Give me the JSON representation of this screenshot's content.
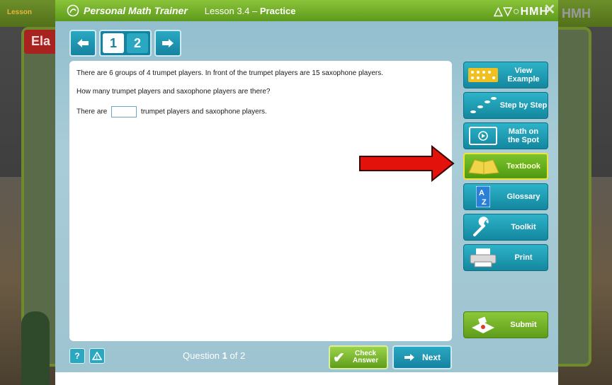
{
  "background": {
    "header_left": "Lesson",
    "header_right": "HMH",
    "title_fragment": "Ela"
  },
  "header": {
    "app_title": "Personal Math Trainer",
    "lesson_number": "Lesson 3.4",
    "lesson_separator": " – ",
    "lesson_mode": "Practice",
    "brand": "HMH"
  },
  "nav": {
    "pages": [
      "1",
      "2"
    ],
    "active_page": "1"
  },
  "question": {
    "line1": "There are 6 groups of 4 trumpet players. In front of the trumpet players are 15 saxophone players.",
    "line2": "How many trumpet players and saxophone players are there?",
    "answer_prefix": "There are",
    "answer_suffix": "trumpet players and saxophone players.",
    "answer_value": ""
  },
  "sidebar": {
    "items": [
      {
        "label_line1": "View",
        "label_line2": "Example",
        "icon": "view-example-icon"
      },
      {
        "label_line1": "Step by Step",
        "label_line2": "",
        "icon": "step-by-step-icon"
      },
      {
        "label_line1": "Math on",
        "label_line2": "the Spot",
        "icon": "video-icon"
      },
      {
        "label_line1": "Textbook",
        "label_line2": "",
        "icon": "book-icon"
      },
      {
        "label_line1": "Glossary",
        "label_line2": "",
        "icon": "glossary-icon"
      },
      {
        "label_line1": "Toolkit",
        "label_line2": "",
        "icon": "wrench-icon"
      },
      {
        "label_line1": "Print",
        "label_line2": "",
        "icon": "printer-icon"
      }
    ],
    "submit": "Submit"
  },
  "footer": {
    "help": "?",
    "alert": "!",
    "question_label": "Question",
    "question_current": "1",
    "question_of": "of 2",
    "check_line1": "Check",
    "check_line2": "Answer",
    "next": "Next"
  },
  "colors": {
    "header_green": "#6fae2a",
    "teal_button": "#1a9bb5",
    "highlight_green": "#5fa318",
    "arrow_red": "#e3120b"
  }
}
